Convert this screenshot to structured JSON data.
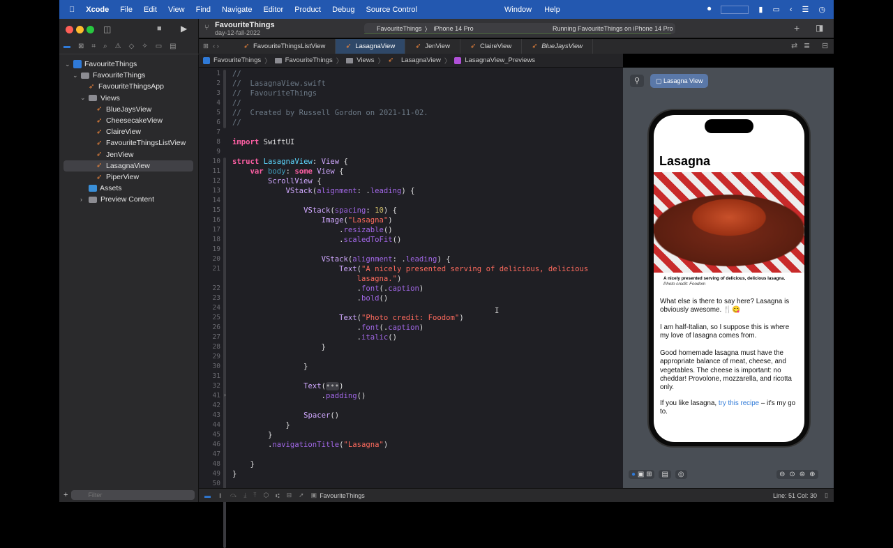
{
  "menubar": {
    "items": [
      "Xcode",
      "File",
      "Edit",
      "View",
      "Find",
      "Navigate",
      "Editor",
      "Product",
      "Debug",
      "Source Control"
    ],
    "right_items": [
      "Window",
      "Help"
    ]
  },
  "toolbar": {
    "project": "FavouriteThings",
    "branch": "day-12-fall-2022",
    "scheme": "FavouriteThings",
    "device": "iPhone 14 Pro",
    "status": "Running FavouriteThings on iPhone 14 Pro"
  },
  "tabs": [
    {
      "label": "FavouriteThingsListView",
      "active": false
    },
    {
      "label": "LasagnaView",
      "active": true
    },
    {
      "label": "JenView",
      "active": false
    },
    {
      "label": "ClaireView",
      "active": false
    },
    {
      "label": "BlueJaysView",
      "active": false,
      "italic": true
    }
  ],
  "jumpbar": [
    "FavouriteThings",
    "FavouriteThings",
    "Views",
    "LasagnaView",
    "LasagnaView_Previews"
  ],
  "navigator": {
    "items": [
      {
        "label": "FavouriteThings",
        "depth": 0,
        "kind": "project",
        "chev": "v"
      },
      {
        "label": "FavouriteThings",
        "depth": 1,
        "kind": "folder",
        "chev": "v"
      },
      {
        "label": "FavouriteThingsApp",
        "depth": 2,
        "kind": "swift"
      },
      {
        "label": "Views",
        "depth": 2,
        "kind": "folder",
        "chev": "v"
      },
      {
        "label": "BlueJaysView",
        "depth": 3,
        "kind": "swift"
      },
      {
        "label": "CheesecakeView",
        "depth": 3,
        "kind": "swift"
      },
      {
        "label": "ClaireView",
        "depth": 3,
        "kind": "swift"
      },
      {
        "label": "FavouriteThingsListView",
        "depth": 3,
        "kind": "swift"
      },
      {
        "label": "JenView",
        "depth": 3,
        "kind": "swift"
      },
      {
        "label": "LasagnaView",
        "depth": 3,
        "kind": "swift",
        "selected": true
      },
      {
        "label": "PiperView",
        "depth": 3,
        "kind": "swift"
      },
      {
        "label": "Assets",
        "depth": 2,
        "kind": "assets"
      },
      {
        "label": "Preview Content",
        "depth": 2,
        "kind": "folder",
        "chev": ">"
      }
    ],
    "filter_placeholder": "Filter"
  },
  "code": [
    {
      "n": "1",
      "t": [
        [
          "//",
          "com"
        ]
      ]
    },
    {
      "n": "2",
      "t": [
        [
          "//  LasagnaView.swift",
          "com"
        ]
      ]
    },
    {
      "n": "3",
      "t": [
        [
          "//  FavouriteThings",
          "com"
        ]
      ]
    },
    {
      "n": "4",
      "t": [
        [
          "//",
          "com"
        ]
      ]
    },
    {
      "n": "5",
      "t": [
        [
          "//  Created by Russell Gordon on 2021-11-02.",
          "com"
        ]
      ]
    },
    {
      "n": "6",
      "t": [
        [
          "//",
          "com"
        ]
      ]
    },
    {
      "n": "7",
      "t": []
    },
    {
      "n": "8",
      "t": [
        [
          "import",
          "kw"
        ],
        [
          " SwiftUI",
          ""
        ]
      ]
    },
    {
      "n": "9",
      "t": []
    },
    {
      "n": "10",
      "t": [
        [
          "struct",
          "kw"
        ],
        [
          " ",
          ""
        ],
        [
          "LasagnaView",
          "decl"
        ],
        [
          ": ",
          ""
        ],
        [
          "View",
          "type"
        ],
        [
          " {",
          ""
        ]
      ]
    },
    {
      "n": "11",
      "t": [
        [
          "    ",
          ""
        ],
        [
          "var",
          "kw"
        ],
        [
          " ",
          ""
        ],
        [
          "body",
          "prop"
        ],
        [
          ": ",
          ""
        ],
        [
          "some",
          "kw"
        ],
        [
          " ",
          ""
        ],
        [
          "View",
          "type"
        ],
        [
          " {",
          ""
        ]
      ]
    },
    {
      "n": "12",
      "t": [
        [
          "        ",
          ""
        ],
        [
          "ScrollView",
          "type"
        ],
        [
          " {",
          ""
        ]
      ]
    },
    {
      "n": "13",
      "t": [
        [
          "            ",
          ""
        ],
        [
          "VStack",
          "type"
        ],
        [
          "(",
          ""
        ],
        [
          "alignment",
          "mem"
        ],
        [
          ": .",
          ""
        ],
        [
          "leading",
          "mem"
        ],
        [
          ") {",
          ""
        ]
      ]
    },
    {
      "n": "14",
      "t": []
    },
    {
      "n": "15",
      "t": [
        [
          "                ",
          ""
        ],
        [
          "VStack",
          "type"
        ],
        [
          "(",
          ""
        ],
        [
          "spacing",
          "mem"
        ],
        [
          ": ",
          ""
        ],
        [
          "10",
          "num"
        ],
        [
          ") {",
          ""
        ]
      ]
    },
    {
      "n": "16",
      "t": [
        [
          "                    ",
          ""
        ],
        [
          "Image",
          "type"
        ],
        [
          "(",
          ""
        ],
        [
          "\"Lasagna\"",
          "str"
        ],
        [
          ")",
          ""
        ]
      ]
    },
    {
      "n": "17",
      "t": [
        [
          "                        .",
          ""
        ],
        [
          "resizable",
          "mem"
        ],
        [
          "()",
          ""
        ]
      ]
    },
    {
      "n": "18",
      "t": [
        [
          "                        .",
          ""
        ],
        [
          "scaledToFit",
          "mem"
        ],
        [
          "()",
          ""
        ]
      ]
    },
    {
      "n": "19",
      "t": []
    },
    {
      "n": "20",
      "t": [
        [
          "                    ",
          ""
        ],
        [
          "VStack",
          "type"
        ],
        [
          "(",
          ""
        ],
        [
          "alignment",
          "mem"
        ],
        [
          ": .",
          ""
        ],
        [
          "leading",
          "mem"
        ],
        [
          ") {",
          ""
        ]
      ]
    },
    {
      "n": "21",
      "t": [
        [
          "                        ",
          ""
        ],
        [
          "Text",
          "type"
        ],
        [
          "(",
          ""
        ],
        [
          "\"A nicely presented serving of delicious, delicious",
          "str"
        ]
      ]
    },
    {
      "n": "",
      "t": [
        [
          "                            ",
          ""
        ],
        [
          "lasagna.\"",
          "str"
        ],
        [
          ")",
          ""
        ]
      ]
    },
    {
      "n": "22",
      "t": [
        [
          "                            .",
          ""
        ],
        [
          "font",
          "mem"
        ],
        [
          "(.",
          ""
        ],
        [
          "caption",
          "mem"
        ],
        [
          ")",
          ""
        ]
      ]
    },
    {
      "n": "23",
      "t": [
        [
          "                            .",
          ""
        ],
        [
          "bold",
          "mem"
        ],
        [
          "()",
          ""
        ]
      ]
    },
    {
      "n": "24",
      "t": []
    },
    {
      "n": "25",
      "t": [
        [
          "                        ",
          ""
        ],
        [
          "Text",
          "type"
        ],
        [
          "(",
          ""
        ],
        [
          "\"Photo credit: Foodom\"",
          "str"
        ],
        [
          ")",
          ""
        ]
      ]
    },
    {
      "n": "26",
      "t": [
        [
          "                            .",
          ""
        ],
        [
          "font",
          "mem"
        ],
        [
          "(.",
          ""
        ],
        [
          "caption",
          "mem"
        ],
        [
          ")",
          ""
        ]
      ]
    },
    {
      "n": "27",
      "t": [
        [
          "                            .",
          ""
        ],
        [
          "italic",
          "mem"
        ],
        [
          "()",
          ""
        ]
      ]
    },
    {
      "n": "28",
      "t": [
        [
          "                    }",
          ""
        ]
      ]
    },
    {
      "n": "29",
      "t": []
    },
    {
      "n": "30",
      "t": [
        [
          "                }",
          ""
        ]
      ]
    },
    {
      "n": "31",
      "t": []
    },
    {
      "n": "32",
      "t": [
        [
          "                ",
          ""
        ],
        [
          "Text",
          "type"
        ],
        [
          "(",
          ""
        ],
        [
          "•••",
          "fold"
        ],
        [
          ")",
          ""
        ]
      ]
    },
    {
      "n": "41",
      "t": [
        [
          "                    .",
          ""
        ],
        [
          "padding",
          "mem"
        ],
        [
          "()",
          ""
        ]
      ]
    },
    {
      "n": "42",
      "t": []
    },
    {
      "n": "43",
      "t": [
        [
          "                ",
          ""
        ],
        [
          "Spacer",
          "type"
        ],
        [
          "()",
          ""
        ]
      ]
    },
    {
      "n": "44",
      "t": [
        [
          "            }",
          ""
        ]
      ]
    },
    {
      "n": "45",
      "t": [
        [
          "        }",
          ""
        ]
      ]
    },
    {
      "n": "46",
      "t": [
        [
          "        .",
          ""
        ],
        [
          "navigationTitle",
          "mem"
        ],
        [
          "(",
          ""
        ],
        [
          "\"Lasagna\"",
          "str"
        ],
        [
          ")",
          ""
        ]
      ]
    },
    {
      "n": "47",
      "t": []
    },
    {
      "n": "48",
      "t": [
        [
          "    }",
          ""
        ]
      ]
    },
    {
      "n": "49",
      "t": [
        [
          "}",
          ""
        ]
      ]
    },
    {
      "n": "50",
      "t": []
    }
  ],
  "preview": {
    "chip": "Lasagna View",
    "title": "Lasagna",
    "caption": "A nicely presented serving of delicious, delicious lasagna.",
    "credit": "Photo credit: Foodom",
    "p1": "What else is there to say here? Lasagna is obviously awesome. 🍴😋",
    "p2": "I am half-Italian, so I suppose this is where my love of lasagna comes from.",
    "p3": "Good homemade lasagna must have the appropriate balance of meat, cheese, and vegetables. The cheese is important: no cheddar! Provolone, mozzarella, and ricotta only.",
    "p4_pre": "If you like lasagna, ",
    "p4_link": "try this recipe",
    "p4_post": " – it's my go to."
  },
  "statusbar": {
    "target": "FavouriteThings",
    "position": "Line: 51  Col: 30"
  },
  "colors": {
    "menubar": "#2358b0",
    "accent": "#2f6fe0",
    "link": "#2f7ad8"
  }
}
